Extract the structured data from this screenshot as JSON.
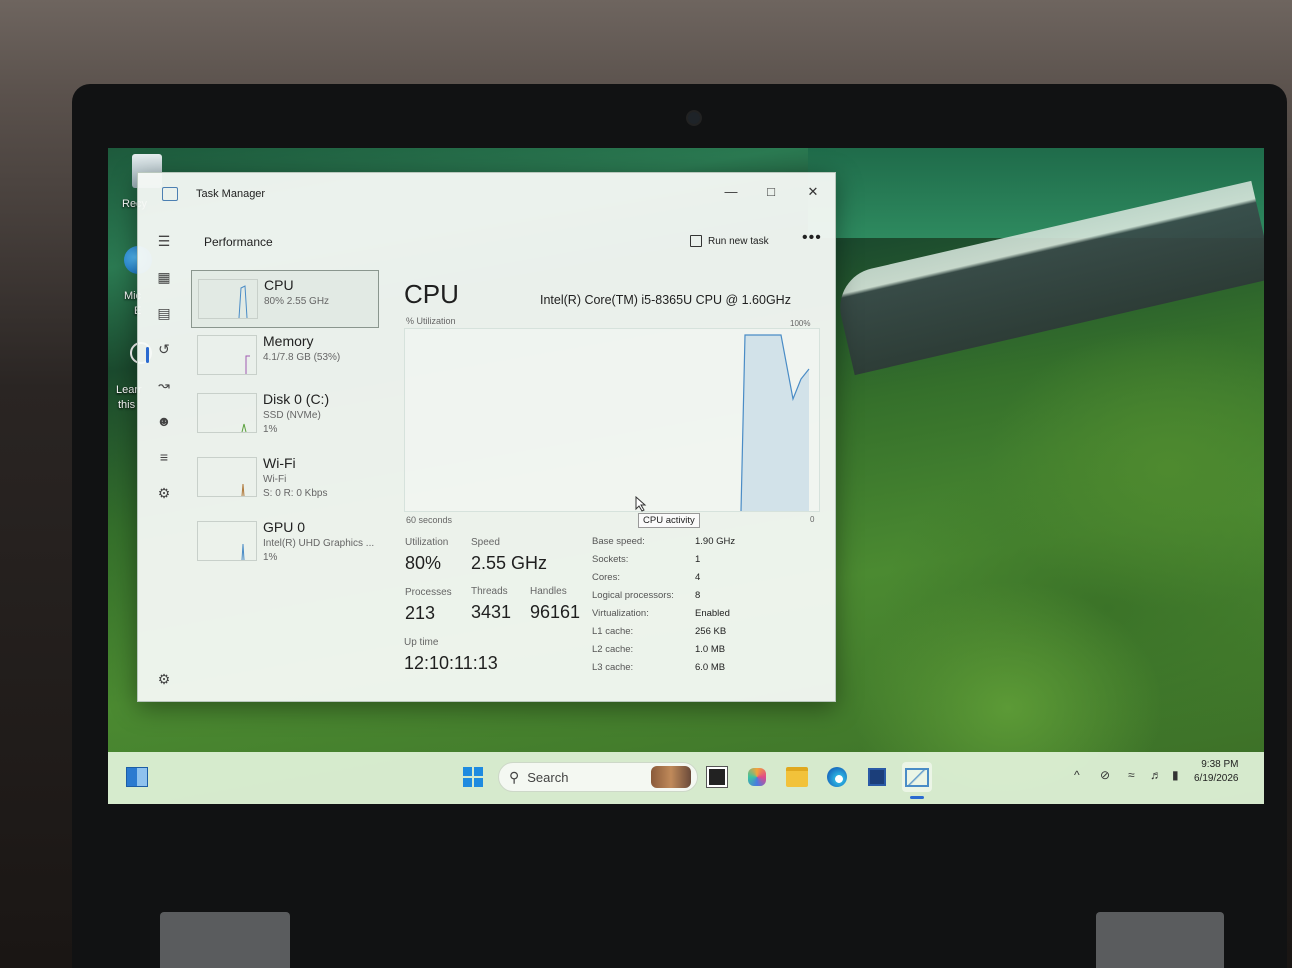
{
  "window": {
    "title": "Task Manager",
    "minimize_icon": "minimize-icon",
    "maximize_icon": "maximize-icon",
    "close_icon": "close-icon"
  },
  "toolbar": {
    "page_title": "Performance",
    "run_new_task": "Run new task",
    "more_label": "•••"
  },
  "nav": {
    "icons": [
      "menu-icon",
      "processes-icon",
      "performance-icon",
      "app-history-icon",
      "startup-apps-icon",
      "users-icon",
      "details-icon",
      "services-icon",
      "settings-icon"
    ]
  },
  "devices": [
    {
      "name": "CPU",
      "sub": "80%  2.55 GHz",
      "sub2": ""
    },
    {
      "name": "Memory",
      "sub": "4.1/7.8 GB (53%)",
      "sub2": ""
    },
    {
      "name": "Disk 0 (C:)",
      "sub": "SSD (NVMe)",
      "sub2": "1%"
    },
    {
      "name": "Wi-Fi",
      "sub": "Wi-Fi",
      "sub2": "S: 0 R: 0 Kbps"
    },
    {
      "name": "GPU 0",
      "sub": "Intel(R) UHD Graphics ...",
      "sub2": "1%"
    }
  ],
  "main": {
    "title": "CPU",
    "model": "Intel(R) Core(TM) i5-8365U CPU @ 1.60GHz",
    "graph_label": "% Utilization",
    "max_label": "100%",
    "min_label": "0",
    "time_label": "60 seconds",
    "tooltip": "CPU activity"
  },
  "stats": {
    "utilization_label": "Utilization",
    "utilization": "80%",
    "speed_label": "Speed",
    "speed": "2.55 GHz",
    "processes_label": "Processes",
    "processes": "213",
    "threads_label": "Threads",
    "threads": "3431",
    "handles_label": "Handles",
    "handles": "96161",
    "uptime_label": "Up time",
    "uptime": "12:10:11:13"
  },
  "specs": [
    {
      "label": "Base speed:",
      "value": "1.90 GHz"
    },
    {
      "label": "Sockets:",
      "value": "1"
    },
    {
      "label": "Cores:",
      "value": "4"
    },
    {
      "label": "Logical processors:",
      "value": "8"
    },
    {
      "label": "Virtualization:",
      "value": "Enabled"
    },
    {
      "label": "L1 cache:",
      "value": "256 KB"
    },
    {
      "label": "L2 cache:",
      "value": "1.0 MB"
    },
    {
      "label": "L3 cache:",
      "value": "6.0 MB"
    }
  ],
  "desktop": {
    "icon1": "Recy",
    "icon2a": "Mic",
    "icon2b": "E",
    "icon3a": "Learr",
    "icon3b": "this"
  },
  "taskbar": {
    "search_placeholder": "Search",
    "time": "9:38 PM",
    "date": "6/19/2026"
  },
  "colors": {
    "accent": "#2a6ad0",
    "graph_line": "#4a8cc6",
    "taskbar_bg": "#def0d6"
  }
}
